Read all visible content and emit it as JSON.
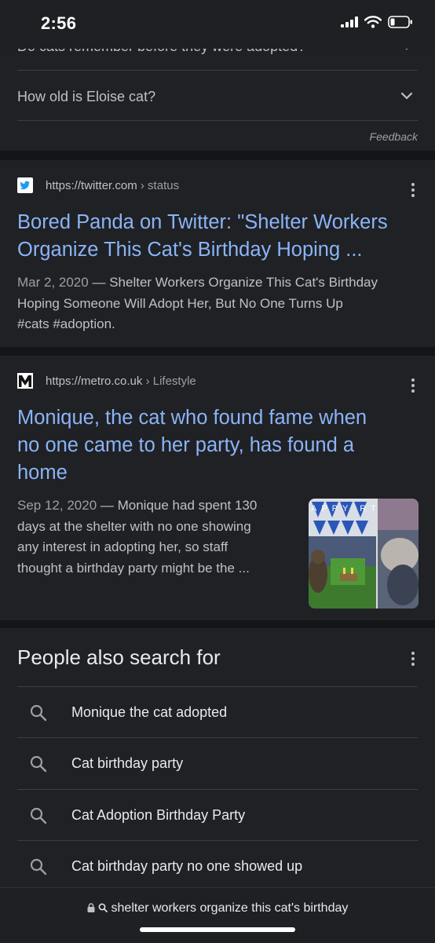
{
  "status_bar": {
    "time": "2:56"
  },
  "people_also_ask": {
    "questions": [
      "Do cats remember before they were adopted?",
      "How old is Eloise cat?"
    ],
    "feedback_label": "Feedback"
  },
  "results": [
    {
      "favicon": "twitter-bird-icon",
      "url": "https://twitter.com",
      "breadcrumb": "› status",
      "title_lines": [
        "Bored Panda on Twitter: \"Shelter Workers",
        "Organize This Cat's Birthday Hoping ..."
      ],
      "date": "Mar 2, 2020",
      "snippet_lines": [
        "— Shelter Workers Organize This Cat's Birthday",
        "Hoping Someone Will Adopt Her, But No One Turns Up",
        "#cats #adoption."
      ]
    },
    {
      "favicon": "metro-m-icon",
      "url": "https://metro.co.uk",
      "breadcrumb": "› Lifestyle",
      "title_lines": [
        "Monique, the cat who found fame when",
        "no one came to her party, has found a",
        "home"
      ],
      "date": "Sep 12, 2020",
      "snippet_lines": [
        "— Monique had spent 130",
        "days at the shelter with no one showing",
        "any interest in adopting her, so staff",
        "thought a birthday party might be the ..."
      ],
      "thumbnail_banner": "APPY RTHDA"
    }
  ],
  "people_also_search_for": {
    "heading": "People also search for",
    "items": [
      "Monique the cat adopted",
      "Cat birthday party",
      "Cat Adoption Birthday Party",
      "Cat birthday party no one showed up"
    ]
  },
  "bottom_bar": {
    "query": "shelter workers organize this cat's birthday"
  },
  "colors": {
    "background": "#141518",
    "card": "#202124",
    "link": "#8ab4f8",
    "text": "#e8eaed",
    "muted": "#bdc1c6"
  }
}
